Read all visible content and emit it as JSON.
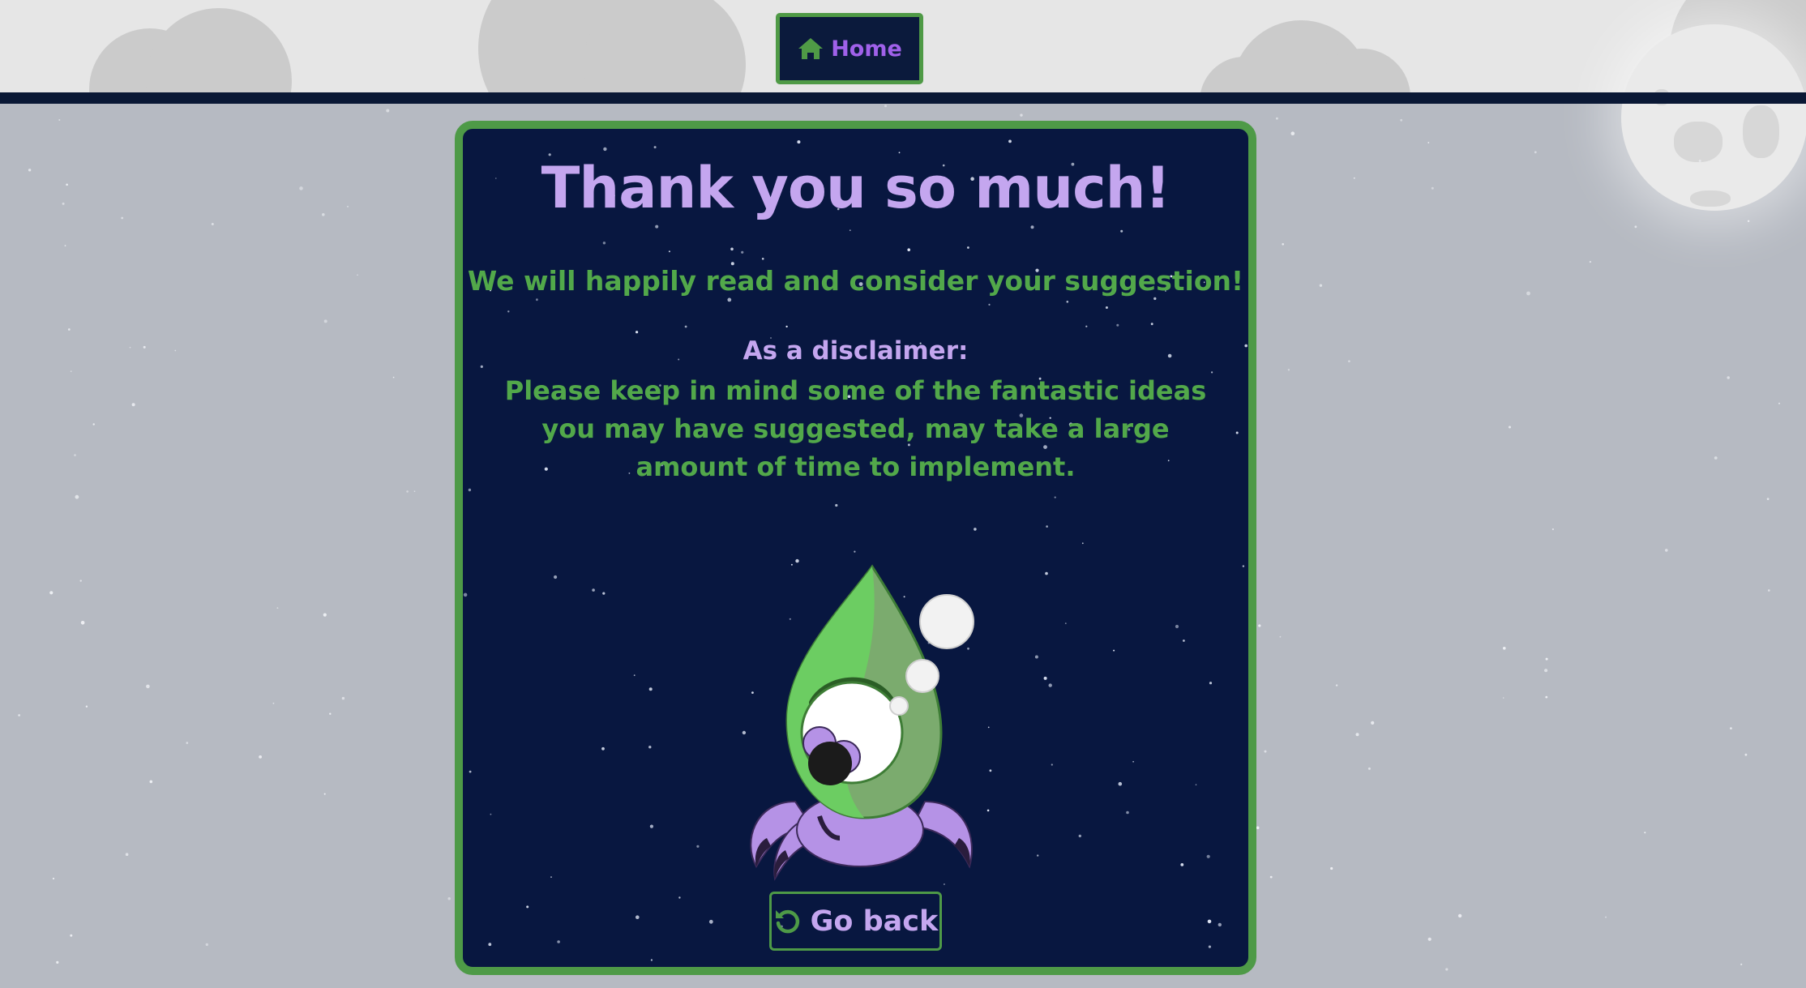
{
  "nav": {
    "home_label": "Home",
    "home_icon": "home-icon"
  },
  "card": {
    "title": "Thank you so much!",
    "subtitle": "We will happily read and consider your suggestion!",
    "disclaimer_heading": "As a disclaimer:",
    "disclaimer_body": "Please keep in mind some of the fantastic ideas you may have suggested, may take a large amount of time to implement.",
    "back_label": "Go back",
    "back_icon": "undo-icon",
    "mascot": "green-alien-mascot"
  },
  "colors": {
    "accent_green": "#4e9a47",
    "accent_purple": "#c4a6ef",
    "panel_bg": "#081740",
    "page_bg": "#b6bac2"
  }
}
